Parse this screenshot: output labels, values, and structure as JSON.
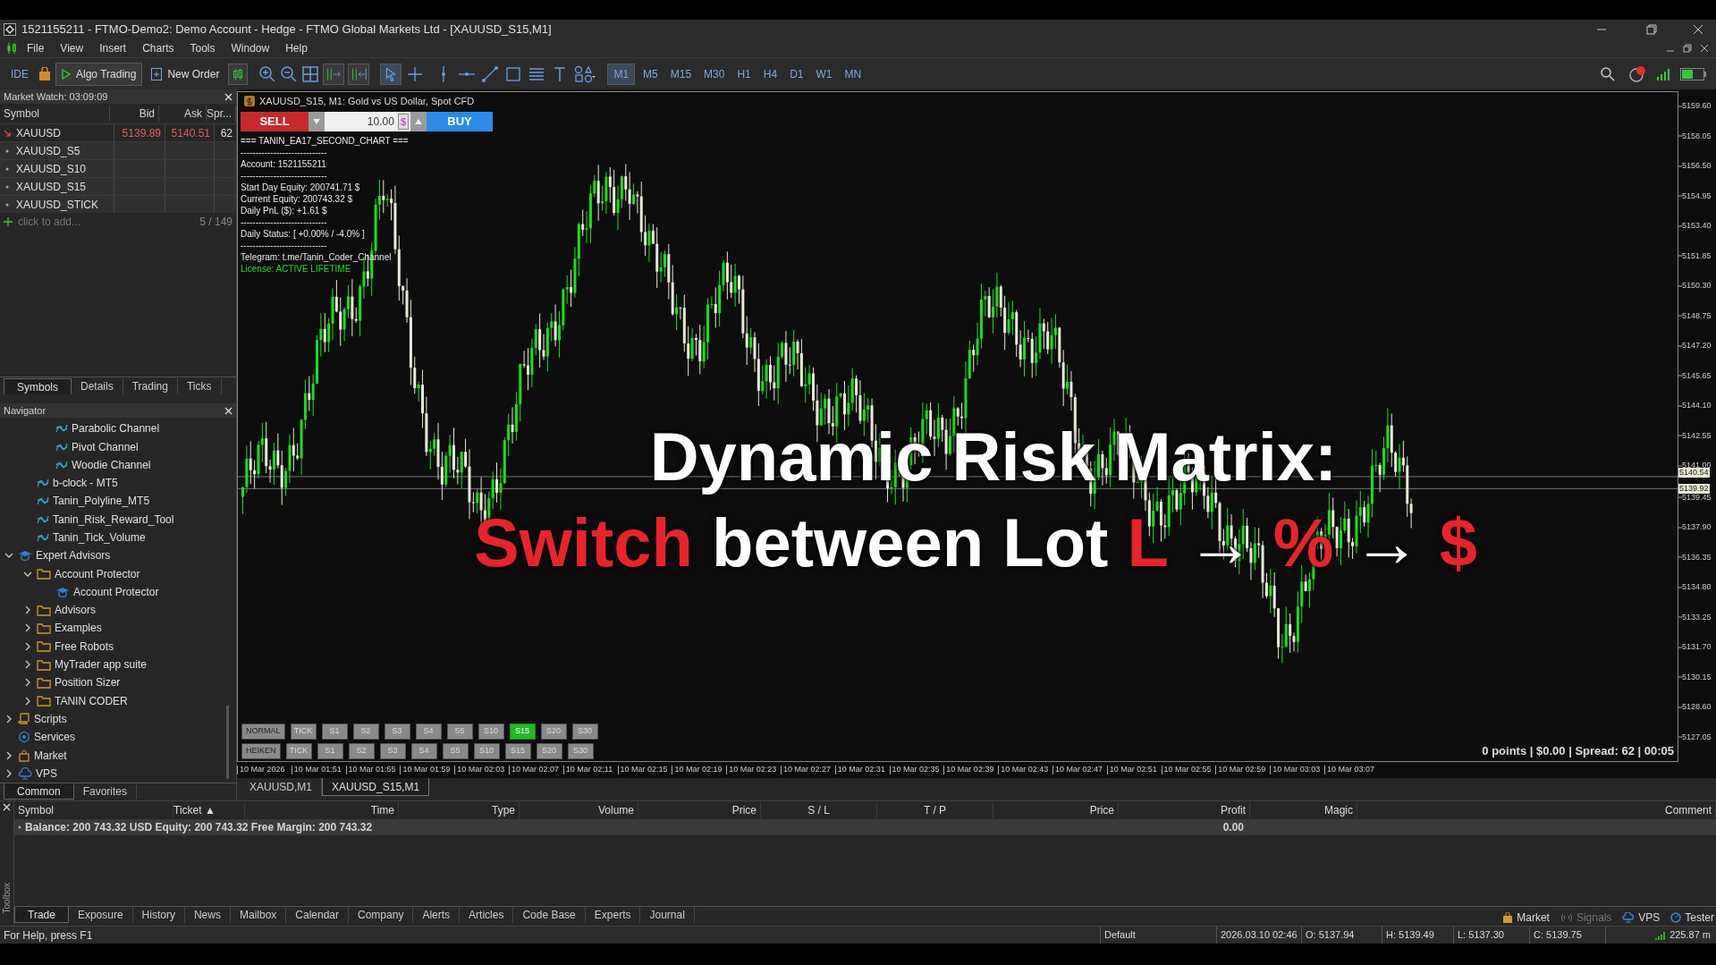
{
  "window": {
    "title": "1521155211 - FTMO-Demo2: Demo Account - Hedge - FTMO Global Markets Ltd - [XAUUSD_S15,M1]"
  },
  "menu": [
    "File",
    "View",
    "Insert",
    "Charts",
    "Tools",
    "Window",
    "Help"
  ],
  "toolbar": {
    "ide": "IDE",
    "algo_trading": "Algo Trading",
    "new_order": "New Order",
    "timeframes": [
      {
        "label": "M1",
        "selected": true
      },
      {
        "label": "M5",
        "selected": false
      },
      {
        "label": "M15",
        "selected": false
      },
      {
        "label": "M30",
        "selected": false
      },
      {
        "label": "H1",
        "selected": false
      },
      {
        "label": "H4",
        "selected": false
      },
      {
        "label": "D1",
        "selected": false
      },
      {
        "label": "W1",
        "selected": false
      },
      {
        "label": "MN",
        "selected": false
      }
    ]
  },
  "market_watch": {
    "title": "Market Watch: 03:09:09",
    "columns": [
      "Symbol",
      "Bid",
      "Ask",
      "Spr..."
    ],
    "rows": [
      {
        "kind": "quote",
        "symbol": "XAUUSD",
        "bid": "5139.89",
        "ask": "5140.51",
        "spread": "62"
      },
      {
        "kind": "symbol",
        "symbol": "XAUUSD_S5"
      },
      {
        "kind": "symbol",
        "symbol": "XAUUSD_S10"
      },
      {
        "kind": "symbol",
        "symbol": "XAUUSD_S15"
      },
      {
        "kind": "symbol",
        "symbol": "XAUUSD_STICK"
      }
    ],
    "add_placeholder": "click to add...",
    "count": "5 / 149",
    "tabs": [
      {
        "label": "Symbols",
        "selected": true
      },
      {
        "label": "Details",
        "selected": false
      },
      {
        "label": "Trading",
        "selected": false
      },
      {
        "label": "Ticks",
        "selected": false
      }
    ]
  },
  "navigator": {
    "title": "Navigator",
    "items": [
      {
        "children": [
          {
            "children": [
              {
                "kind": "indicator",
                "label": "Parabolic Channel"
              },
              {
                "kind": "indicator",
                "label": "Pivot Channel"
              },
              {
                "kind": "indicator",
                "label": "Woodie Channel"
              }
            ]
          },
          {
            "kind": "indicator",
            "label": "b-clock - MT5"
          },
          {
            "kind": "indicator",
            "label": "Tanin_Polyline_MT5"
          },
          {
            "kind": "indicator",
            "label": "Tanin_Risk_Reward_Tool"
          },
          {
            "kind": "indicator",
            "label": "Tanin_Tick_Volume"
          }
        ]
      },
      {
        "kind": "expert",
        "label": "Expert Advisors",
        "expanded": true,
        "children": [
          {
            "kind": "folder",
            "label": "Account Protector",
            "expanded": true,
            "children": [
              {
                "kind": "expert",
                "label": "Account Protector"
              }
            ]
          },
          {
            "kind": "folder",
            "label": "Advisors",
            "expanded": false
          },
          {
            "kind": "folder",
            "label": "Examples",
            "expanded": false
          },
          {
            "kind": "folder",
            "label": "Free Robots",
            "expanded": false
          },
          {
            "kind": "folder",
            "label": "MyTrader app suite",
            "expanded": false
          },
          {
            "kind": "folder",
            "label": "Position Sizer",
            "expanded": false
          },
          {
            "kind": "folder",
            "label": "TANIN CODER",
            "expanded": false
          }
        ]
      },
      {
        "kind": "scripts",
        "label": "Scripts",
        "expanded": false
      },
      {
        "kind": "services",
        "label": "Services"
      },
      {
        "kind": "market",
        "label": "Market",
        "expanded": false
      },
      {
        "kind": "vps",
        "label": "VPS",
        "expanded": false
      }
    ],
    "tabs": [
      {
        "label": "Common",
        "selected": true
      },
      {
        "label": "Favorites",
        "selected": false
      }
    ]
  },
  "chart": {
    "title": "XAUUSD_S15, M1:  Gold vs US Dollar, Spot CFD",
    "trade_panel": {
      "sell": "SELL",
      "volume": "10.00",
      "currency": "$",
      "buy": "BUY"
    },
    "info_lines": [
      {
        "kind": "text",
        "text": "=== TANIN_EA17_SECOND_CHART ==="
      },
      {
        "kind": "text",
        "text": "-----------------------------"
      },
      {
        "kind": "text",
        "text": "Account: 1521155211"
      },
      {
        "kind": "text",
        "text": "-----------------------------"
      },
      {
        "kind": "text",
        "text": "Start Day Equity: 200741.71 $"
      },
      {
        "kind": "text",
        "text": "Current Equity: 200743.32 $"
      },
      {
        "kind": "text",
        "text": "Daily PnL ($): +1.61 $"
      },
      {
        "kind": "text",
        "text": "-----------------------------"
      },
      {
        "kind": "text",
        "text": "Daily Status: [ +0.00% / -4.0% ]"
      },
      {
        "kind": "text",
        "text": "-----------------------------"
      },
      {
        "kind": "text",
        "text": "Telegram: t.me/Tanin_Coder_Channel"
      },
      {
        "kind": "license",
        "text": "License: ACTIVE LIFETIME"
      }
    ],
    "headline": "Dynamic Risk Matrix:",
    "subline": [
      {
        "text": "Switch",
        "accent": true
      },
      {
        "text": " between Lot ",
        "accent": false
      },
      {
        "text": "L",
        "accent": true
      },
      {
        "text": " → ",
        "accent": false
      },
      {
        "text": "%",
        "accent": true
      },
      {
        "text": " → ",
        "accent": false
      },
      {
        "text": "$",
        "accent": true
      }
    ],
    "mode_rows": [
      {
        "label": "NORMAL",
        "buttons": [
          {
            "label": "TICK",
            "selected": false
          },
          {
            "label": "S1",
            "selected": false
          },
          {
            "label": "S2",
            "selected": false
          },
          {
            "label": "S3",
            "selected": false
          },
          {
            "label": "S4",
            "selected": false
          },
          {
            "label": "S5",
            "selected": false
          },
          {
            "label": "S10",
            "selected": false
          },
          {
            "label": "S15",
            "selected": true
          },
          {
            "label": "S20",
            "selected": false
          },
          {
            "label": "S30",
            "selected": false
          }
        ]
      },
      {
        "label": "HEIKEN",
        "buttons": [
          {
            "label": "TICK",
            "selected": false
          },
          {
            "label": "S1",
            "selected": false
          },
          {
            "label": "S2",
            "selected": false
          },
          {
            "label": "S3",
            "selected": false
          },
          {
            "label": "S4",
            "selected": false
          },
          {
            "label": "S5",
            "selected": false
          },
          {
            "label": "S10",
            "selected": false
          },
          {
            "label": "S15",
            "selected": false
          },
          {
            "label": "S20",
            "selected": false
          },
          {
            "label": "S30",
            "selected": false
          }
        ]
      }
    ],
    "status": "0 points | $0.00 | Spread: 62 | 00:05",
    "price_axis": [
      "5159.60",
      "5158.05",
      "5156.50",
      "5154.95",
      "5153.40",
      "5151.85",
      "5150.30",
      "5148.75",
      "5147.20",
      "5145.65",
      "5144.10",
      "5142.55",
      "5141.00",
      "5139.45",
      "5137.90",
      "5136.35",
      "5134.80",
      "5133.25",
      "5131.70",
      "5130.15",
      "5128.60",
      "5127.05"
    ],
    "ask_tag": "5140.54",
    "bid_tag": "5139.92",
    "time_axis": [
      "10 Mar 2026",
      "10 Mar 01:51",
      "10 Mar 01:55",
      "10 Mar 01:59",
      "10 Mar 02:03",
      "10 Mar 02:07",
      "10 Mar 02:11",
      "10 Mar 02:15",
      "10 Mar 02:19",
      "10 Mar 02:23",
      "10 Mar 02:27",
      "10 Mar 02:31",
      "10 Mar 02:35",
      "10 Mar 02:39",
      "10 Mar 02:43",
      "10 Mar 02:47",
      "10 Mar 02:51",
      "10 Mar 02:55",
      "10 Mar 02:59",
      "10 Mar 03:03",
      "10 Mar 03:07"
    ]
  },
  "chart_tabs": [
    {
      "label": "XAUUSD,M1",
      "selected": false
    },
    {
      "label": "XAUUSD_S15,M1",
      "selected": true
    }
  ],
  "toolbox": {
    "side_label": "Toolbox",
    "columns": [
      "Symbol",
      "Ticket ▲",
      "Time",
      "Type",
      "Volume",
      "Price",
      "S / L",
      "T / P",
      "Price",
      "Profit",
      "Magic",
      "Comment"
    ],
    "balance": "Balance: 200 743.32 USD  Equity: 200 743.32  Free Margin: 200 743.32",
    "profit": "0.00",
    "tabs": [
      {
        "label": "Trade",
        "selected": true
      },
      {
        "label": "Exposure",
        "selected": false
      },
      {
        "label": "History",
        "selected": false
      },
      {
        "label": "News",
        "selected": false
      },
      {
        "label": "Mailbox",
        "selected": false
      },
      {
        "label": "Calendar",
        "selected": false
      },
      {
        "label": "Company",
        "selected": false
      },
      {
        "label": "Alerts",
        "selected": false
      },
      {
        "label": "Articles",
        "selected": false
      },
      {
        "label": "Code Base",
        "selected": false
      },
      {
        "label": "Experts",
        "selected": false
      },
      {
        "label": "Journal",
        "selected": false
      }
    ],
    "links": [
      {
        "kind": "market",
        "label": "Market",
        "disabled": false
      },
      {
        "kind": "signals",
        "label": "Signals",
        "disabled": true
      },
      {
        "kind": "vps",
        "label": "VPS",
        "disabled": false
      },
      {
        "kind": "tester",
        "label": "Tester",
        "disabled": false
      }
    ]
  },
  "status_bar": {
    "help": "For Help, press F1",
    "profile": "Default",
    "datetime": "2026.03.10 02:46",
    "open": "O: 5137.94",
    "high": "H: 5139.49",
    "low": "L: 5137.30",
    "close": "C: 5139.75",
    "traffic": "225.87 m"
  }
}
